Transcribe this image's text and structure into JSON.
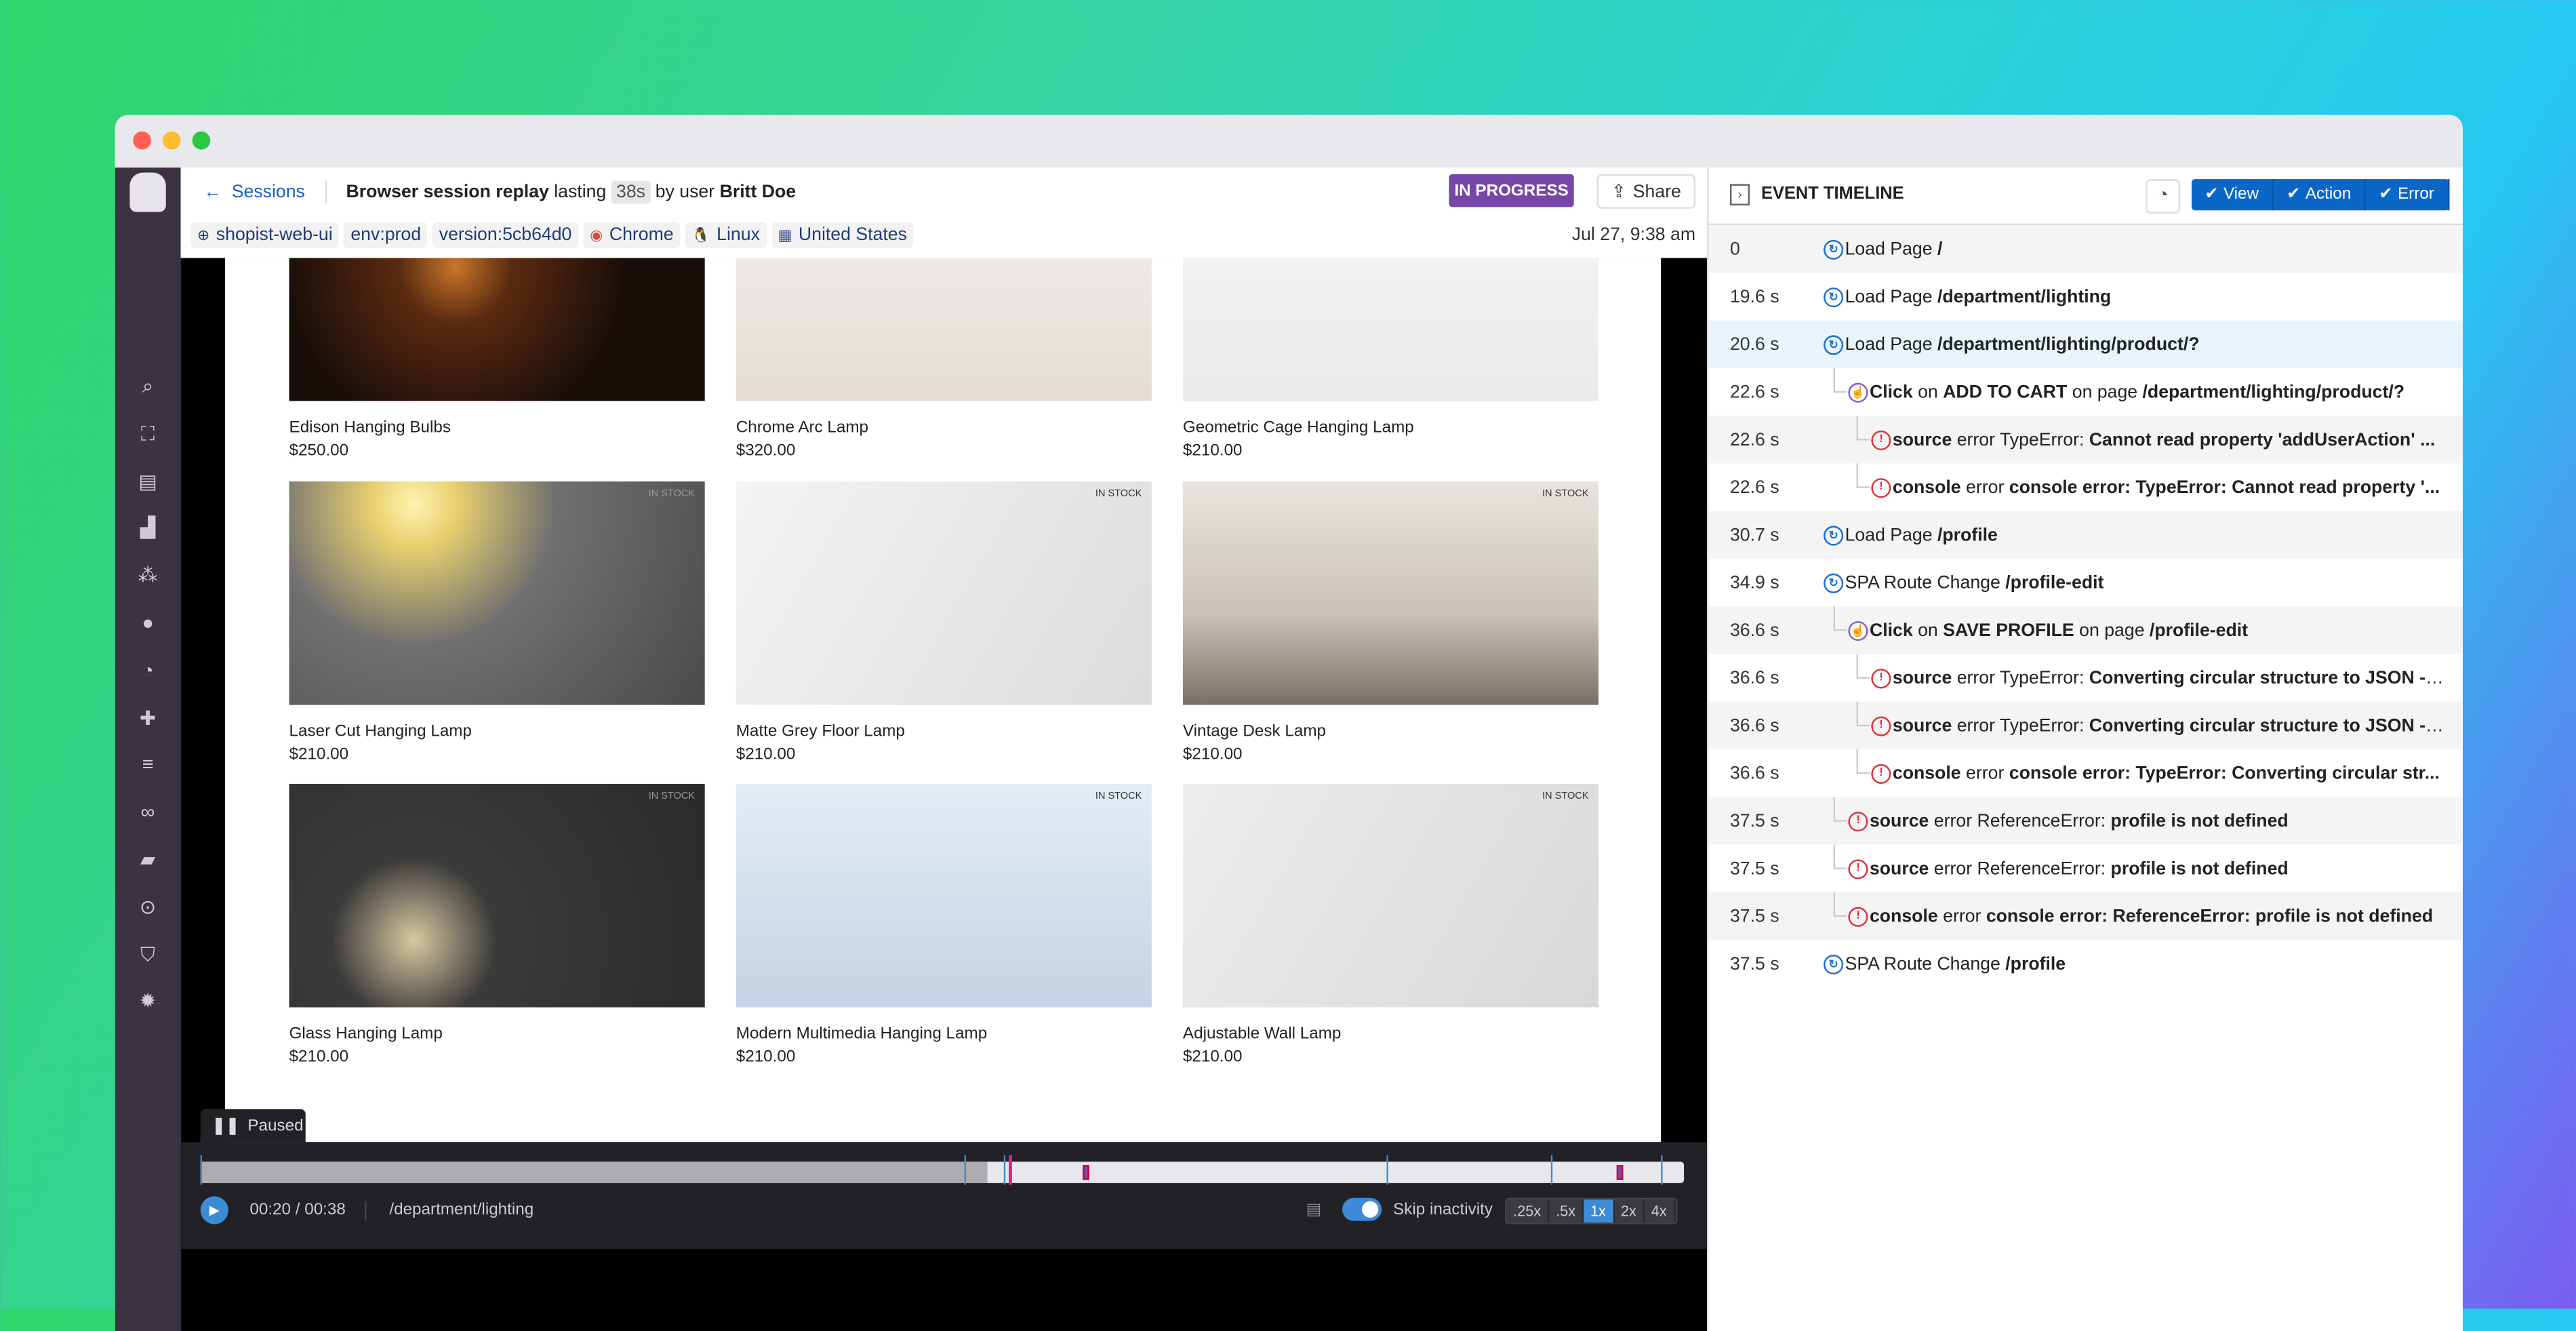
{
  "header": {
    "back_label": "Sessions",
    "title_prefix": "Browser session replay",
    "lasting": "lasting",
    "duration": "38s",
    "by_user": "by user",
    "user": "Britt Doe",
    "status": "IN PROGRESS",
    "share_label": "Share",
    "date": "Jul 27, 9:38 am",
    "tags": [
      {
        "icon": "globe-icon",
        "label": "shopist-web-ui"
      },
      {
        "icon": "",
        "label": "env:prod"
      },
      {
        "icon": "",
        "label": "version:5cb64d0"
      },
      {
        "icon": "chrome-icon",
        "label": "Chrome"
      },
      {
        "icon": "linux-icon",
        "label": "Linux"
      },
      {
        "icon": "us-flag-icon",
        "label": "United States"
      }
    ]
  },
  "products": [
    {
      "name": "Edison Hanging Bulbs",
      "price": "$250.00",
      "stock": ""
    },
    {
      "name": "Chrome Arc Lamp",
      "price": "$320.00",
      "stock": ""
    },
    {
      "name": "Geometric Cage Hanging Lamp",
      "price": "$210.00",
      "stock": ""
    },
    {
      "name": "Laser Cut Hanging Lamp",
      "price": "$210.00",
      "stock": "IN STOCK"
    },
    {
      "name": "Matte Grey Floor Lamp",
      "price": "$210.00",
      "stock": "IN STOCK"
    },
    {
      "name": "Vintage Desk Lamp",
      "price": "$210.00",
      "stock": "IN STOCK"
    },
    {
      "name": "Glass Hanging Lamp",
      "price": "$210.00",
      "stock": "IN STOCK"
    },
    {
      "name": "Modern Multimedia Hanging Lamp",
      "price": "$210.00",
      "stock": "IN STOCK"
    },
    {
      "name": "Adjustable Wall Lamp",
      "price": "$210.00",
      "stock": "IN STOCK"
    }
  ],
  "player": {
    "paused_label": "Paused",
    "time": "00:20 / 00:38",
    "url": "/department/lighting",
    "skip_label": "Skip inactivity",
    "progress": 0.53,
    "speeds": [
      ".25x",
      ".5x",
      "1x",
      "2x",
      "4x"
    ],
    "active_speed": "1x"
  },
  "timeline": {
    "title": "EVENT TIMELINE",
    "filters": [
      "View",
      "Action",
      "Error"
    ],
    "rows": [
      {
        "time": "0",
        "type": "view",
        "level": 0,
        "parts": [
          [
            "Load Page ",
            0
          ],
          [
            "/",
            1
          ]
        ]
      },
      {
        "time": "19.6 s",
        "type": "view",
        "level": 0,
        "parts": [
          [
            "Load Page ",
            0
          ],
          [
            "/department/lighting",
            1
          ]
        ]
      },
      {
        "time": "20.6 s",
        "type": "view",
        "level": 0,
        "selected": true,
        "parts": [
          [
            "Load Page ",
            0
          ],
          [
            "/department/lighting/product/?",
            1
          ]
        ]
      },
      {
        "time": "22.6 s",
        "type": "action",
        "level": 1,
        "parts": [
          [
            "Click",
            1
          ],
          [
            " on ",
            0
          ],
          [
            "ADD TO CART",
            1
          ],
          [
            " on page ",
            0
          ],
          [
            "/department/lighting/product/?",
            1
          ]
        ]
      },
      {
        "time": "22.6 s",
        "type": "error",
        "level": 2,
        "parts": [
          [
            "source",
            1
          ],
          [
            " error TypeError: ",
            0
          ],
          [
            "Cannot read property 'addUserAction' ...",
            1
          ]
        ]
      },
      {
        "time": "22.6 s",
        "type": "error",
        "level": 2,
        "parts": [
          [
            "console",
            1
          ],
          [
            " error ",
            0
          ],
          [
            "console error: TypeError: Cannot read property '...",
            1
          ]
        ]
      },
      {
        "time": "30.7 s",
        "type": "view",
        "level": 0,
        "parts": [
          [
            "Load Page ",
            0
          ],
          [
            "/profile",
            1
          ]
        ]
      },
      {
        "time": "34.9 s",
        "type": "view",
        "level": 0,
        "parts": [
          [
            "SPA Route Change ",
            0
          ],
          [
            "/profile-edit",
            1
          ]
        ]
      },
      {
        "time": "36.6 s",
        "type": "action",
        "level": 1,
        "parts": [
          [
            "Click",
            1
          ],
          [
            " on ",
            0
          ],
          [
            "SAVE PROFILE",
            1
          ],
          [
            " on page ",
            0
          ],
          [
            "/profile-edit",
            1
          ]
        ]
      },
      {
        "time": "36.6 s",
        "type": "error",
        "level": 2,
        "parts": [
          [
            "source",
            1
          ],
          [
            " error TypeError: ",
            0
          ],
          [
            "Converting circular structure to JSON --...",
            1
          ]
        ]
      },
      {
        "time": "36.6 s",
        "type": "error",
        "level": 2,
        "parts": [
          [
            "source",
            1
          ],
          [
            " error TypeError: ",
            0
          ],
          [
            "Converting circular structure to JSON --...",
            1
          ]
        ]
      },
      {
        "time": "36.6 s",
        "type": "error",
        "level": 2,
        "parts": [
          [
            "console",
            1
          ],
          [
            " error ",
            0
          ],
          [
            "console error: TypeError: Converting circular str...",
            1
          ]
        ]
      },
      {
        "time": "37.5 s",
        "type": "error",
        "level": 1,
        "parts": [
          [
            "source",
            1
          ],
          [
            " error ReferenceError: ",
            0
          ],
          [
            "profile is not defined",
            1
          ]
        ]
      },
      {
        "time": "37.5 s",
        "type": "error",
        "level": 1,
        "parts": [
          [
            "source",
            1
          ],
          [
            " error ReferenceError: ",
            0
          ],
          [
            "profile is not defined",
            1
          ]
        ]
      },
      {
        "time": "37.5 s",
        "type": "error",
        "level": 1,
        "parts": [
          [
            "console",
            1
          ],
          [
            " error ",
            0
          ],
          [
            "console error: ReferenceError: profile is not defined",
            1
          ]
        ]
      },
      {
        "time": "37.5 s",
        "type": "view",
        "level": 0,
        "parts": [
          [
            "SPA Route Change ",
            0
          ],
          [
            "/profile",
            1
          ]
        ]
      }
    ]
  },
  "colors": {
    "view": "#1a6fd0",
    "action": "#8a5cc9",
    "error": "#e0303a",
    "accent": "#0a67c8",
    "status": "#7646a8"
  }
}
